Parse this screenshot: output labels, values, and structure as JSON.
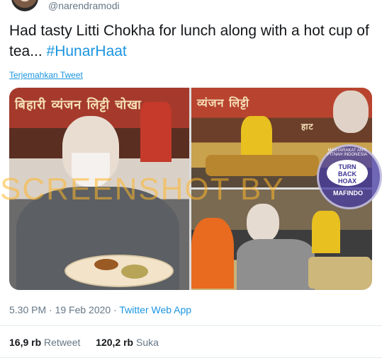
{
  "tweet": {
    "handle": "@narendramodi",
    "text_main": "Had tasty Litti Chokha for lunch along with a hot cup of tea... ",
    "hashtag": "#HunarHaat",
    "translate_label": "Terjemahkan Tweet",
    "time": "5.30 PM · 19 Feb 2020",
    "separator": " · ",
    "source": "Twitter Web App",
    "retweets_count": "16,9 rb",
    "retweets_label": "Retweet",
    "likes_count": "120,2 rb",
    "likes_label": "Suka"
  },
  "photos": {
    "left_banner": "बिहारी व्यंजन लिट्टी चोखा",
    "top_right_banner": "व्यंजन लिट्टी",
    "top_right_sign": "हाट"
  },
  "overlay": {
    "watermark": "SCREENSHOT BY",
    "badge_ring": "MASYARAKAT ANTI FITNAH INDONESIA",
    "badge_center_1": "TURN",
    "badge_center_2": "BACK",
    "badge_center_3": "HOAX",
    "badge_bottom": "MAFINDO"
  }
}
